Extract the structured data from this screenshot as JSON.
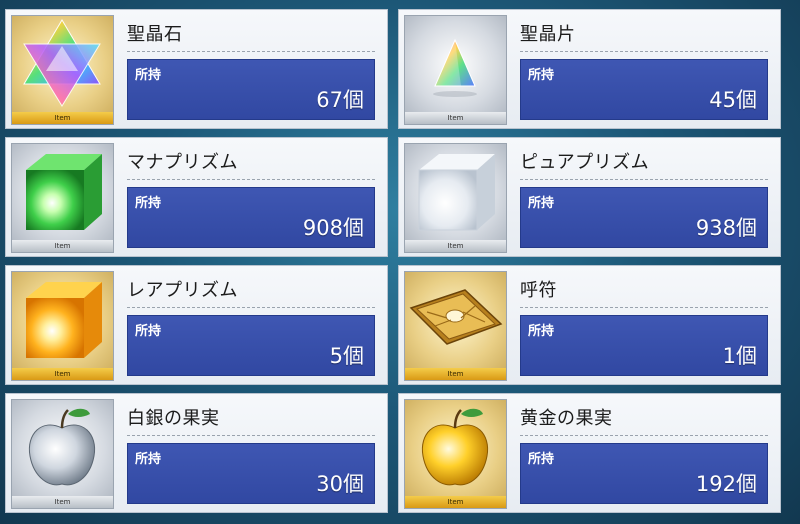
{
  "owned_label": "所持",
  "item_tag": "Item",
  "items": [
    {
      "name": "聖晶石",
      "count": "67個",
      "icon": "saint-quartz-icon",
      "frame": "gold"
    },
    {
      "name": "聖晶片",
      "count": "45個",
      "icon": "quartz-fragment-icon",
      "frame": "silver"
    },
    {
      "name": "マナプリズム",
      "count": "908個",
      "icon": "mana-prism-icon",
      "frame": "silver"
    },
    {
      "name": "ピュアプリズム",
      "count": "938個",
      "icon": "pure-prism-icon",
      "frame": "silver"
    },
    {
      "name": "レアプリズム",
      "count": "5個",
      "icon": "rare-prism-icon",
      "frame": "gold"
    },
    {
      "name": "呼符",
      "count": "1個",
      "icon": "summon-ticket-icon",
      "frame": "gold"
    },
    {
      "name": "白銀の果実",
      "count": "30個",
      "icon": "silver-apple-icon",
      "frame": "silver"
    },
    {
      "name": "黄金の果実",
      "count": "192個",
      "icon": "gold-apple-icon",
      "frame": "gold"
    }
  ],
  "colors": {
    "panel": "#3a52ad",
    "gold_tag": "#e6b12d",
    "silver_tag": "#cfd4da"
  }
}
